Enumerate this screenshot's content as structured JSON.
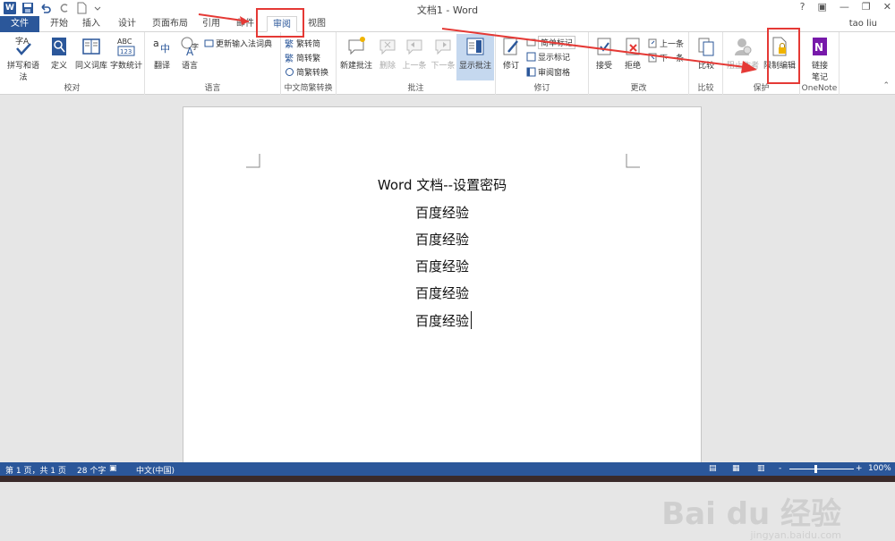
{
  "window": {
    "title": "文档1 - Word",
    "user": "tao liu",
    "help": "?",
    "minimize": "—",
    "restore": "❐",
    "close": "✕"
  },
  "tabs": [
    {
      "label": "文件"
    },
    {
      "label": "开始"
    },
    {
      "label": "插入"
    },
    {
      "label": "设计"
    },
    {
      "label": "页面布局"
    },
    {
      "label": "引用"
    },
    {
      "label": "邮件"
    },
    {
      "label": "审阅"
    },
    {
      "label": "视图"
    }
  ],
  "ribbon": {
    "proofing": {
      "label": "校对",
      "spelling": "拼写和语法",
      "define": "定义",
      "thesaurus": "同义词库",
      "wordcount": "字数统计"
    },
    "language": {
      "label": "语言",
      "translate": "翻译",
      "language": "语言",
      "update_ime": "更新输入法词典"
    },
    "chinese": {
      "label": "中文简繁转换",
      "to_simplified": "繁转简",
      "to_traditional": "简转繁",
      "convert": "简繁转换"
    },
    "comments": {
      "label": "批注",
      "new": "新建批注",
      "delete": "删除",
      "prev": "上一条",
      "next": "下一条",
      "show": "显示批注"
    },
    "tracking": {
      "label": "修订",
      "track": "修订",
      "markup_select": "简单标记",
      "show_markup": "显示标记",
      "review_pane": "审阅窗格"
    },
    "changes": {
      "label": "更改",
      "accept": "接受",
      "reject": "拒绝",
      "prev": "上一条",
      "next": "下一条"
    },
    "compare": {
      "label": "比较",
      "compare": "比较"
    },
    "protect": {
      "label": "保护",
      "block_authors": "阻止作者",
      "restrict": "限制编辑"
    },
    "onenote": {
      "label": "OneNote",
      "linked_notes": "链接\n笔记"
    }
  },
  "document": {
    "lines": [
      "Word 文档--设置密码",
      "百度经验",
      "百度经验",
      "百度经验",
      "百度经验",
      "百度经验"
    ]
  },
  "status": {
    "page": "第 1 页，共 1 页",
    "words": "28 个字",
    "language": "中文(中国)",
    "zoom": "100%",
    "zoom_minus": "-",
    "zoom_plus": "+"
  },
  "watermark": {
    "brand": "Bai du 经验",
    "url": "jingyan.baidu.com"
  },
  "colors": {
    "accent": "#2b579a",
    "highlight": "#e53935"
  }
}
